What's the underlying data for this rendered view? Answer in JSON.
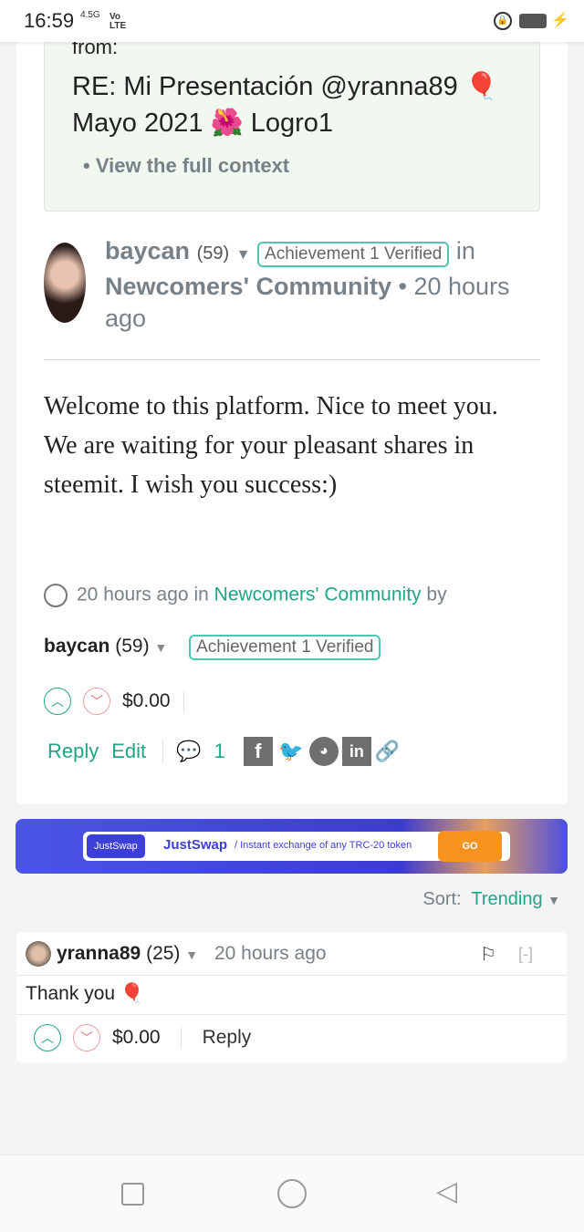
{
  "status_bar": {
    "time": "16:59",
    "network": "4.5G",
    "volte": "Vo LTE"
  },
  "context_box": {
    "from_label": "from:",
    "title_line1": "RE: Mi Presentación @yranna89 🎈",
    "title_line2": "Mayo 2021 🌺 Logro1",
    "view_context": "View the full context"
  },
  "post": {
    "author": "baycan",
    "reputation": "(59)",
    "badge": "Achievement 1 Verified",
    "in_label": "in",
    "community": "Newcomers' Community",
    "time_sep": "•",
    "time": "20 hours ago",
    "body": "Welcome to this platform. Nice to meet you. We are waiting for your pleasant shares in steemit. I wish you success:)",
    "footer_time": "20 hours ago",
    "footer_in": "in",
    "footer_community": "Newcomers' Community",
    "footer_by": "by",
    "payout": "$0.00",
    "reply": "Reply",
    "edit": "Edit",
    "comment_count": "1"
  },
  "ad": {
    "logo": "JustSwap",
    "name": "JustSwap",
    "tagline": "/ Instant exchange of any TRC-20 token",
    "cta": "GO"
  },
  "sort": {
    "label": "Sort:",
    "value": "Trending"
  },
  "comment": {
    "author": "yranna89",
    "reputation": "(25)",
    "time": "20 hours ago",
    "collapse": "[-]",
    "body": "Thank you 🎈",
    "payout": "$0.00",
    "reply": "Reply"
  },
  "colors": {
    "accent": "#1fa587",
    "context_bg": "#f0f8f0",
    "ad_bg": "#4b4fe0",
    "ad_cta": "#f7931e"
  }
}
